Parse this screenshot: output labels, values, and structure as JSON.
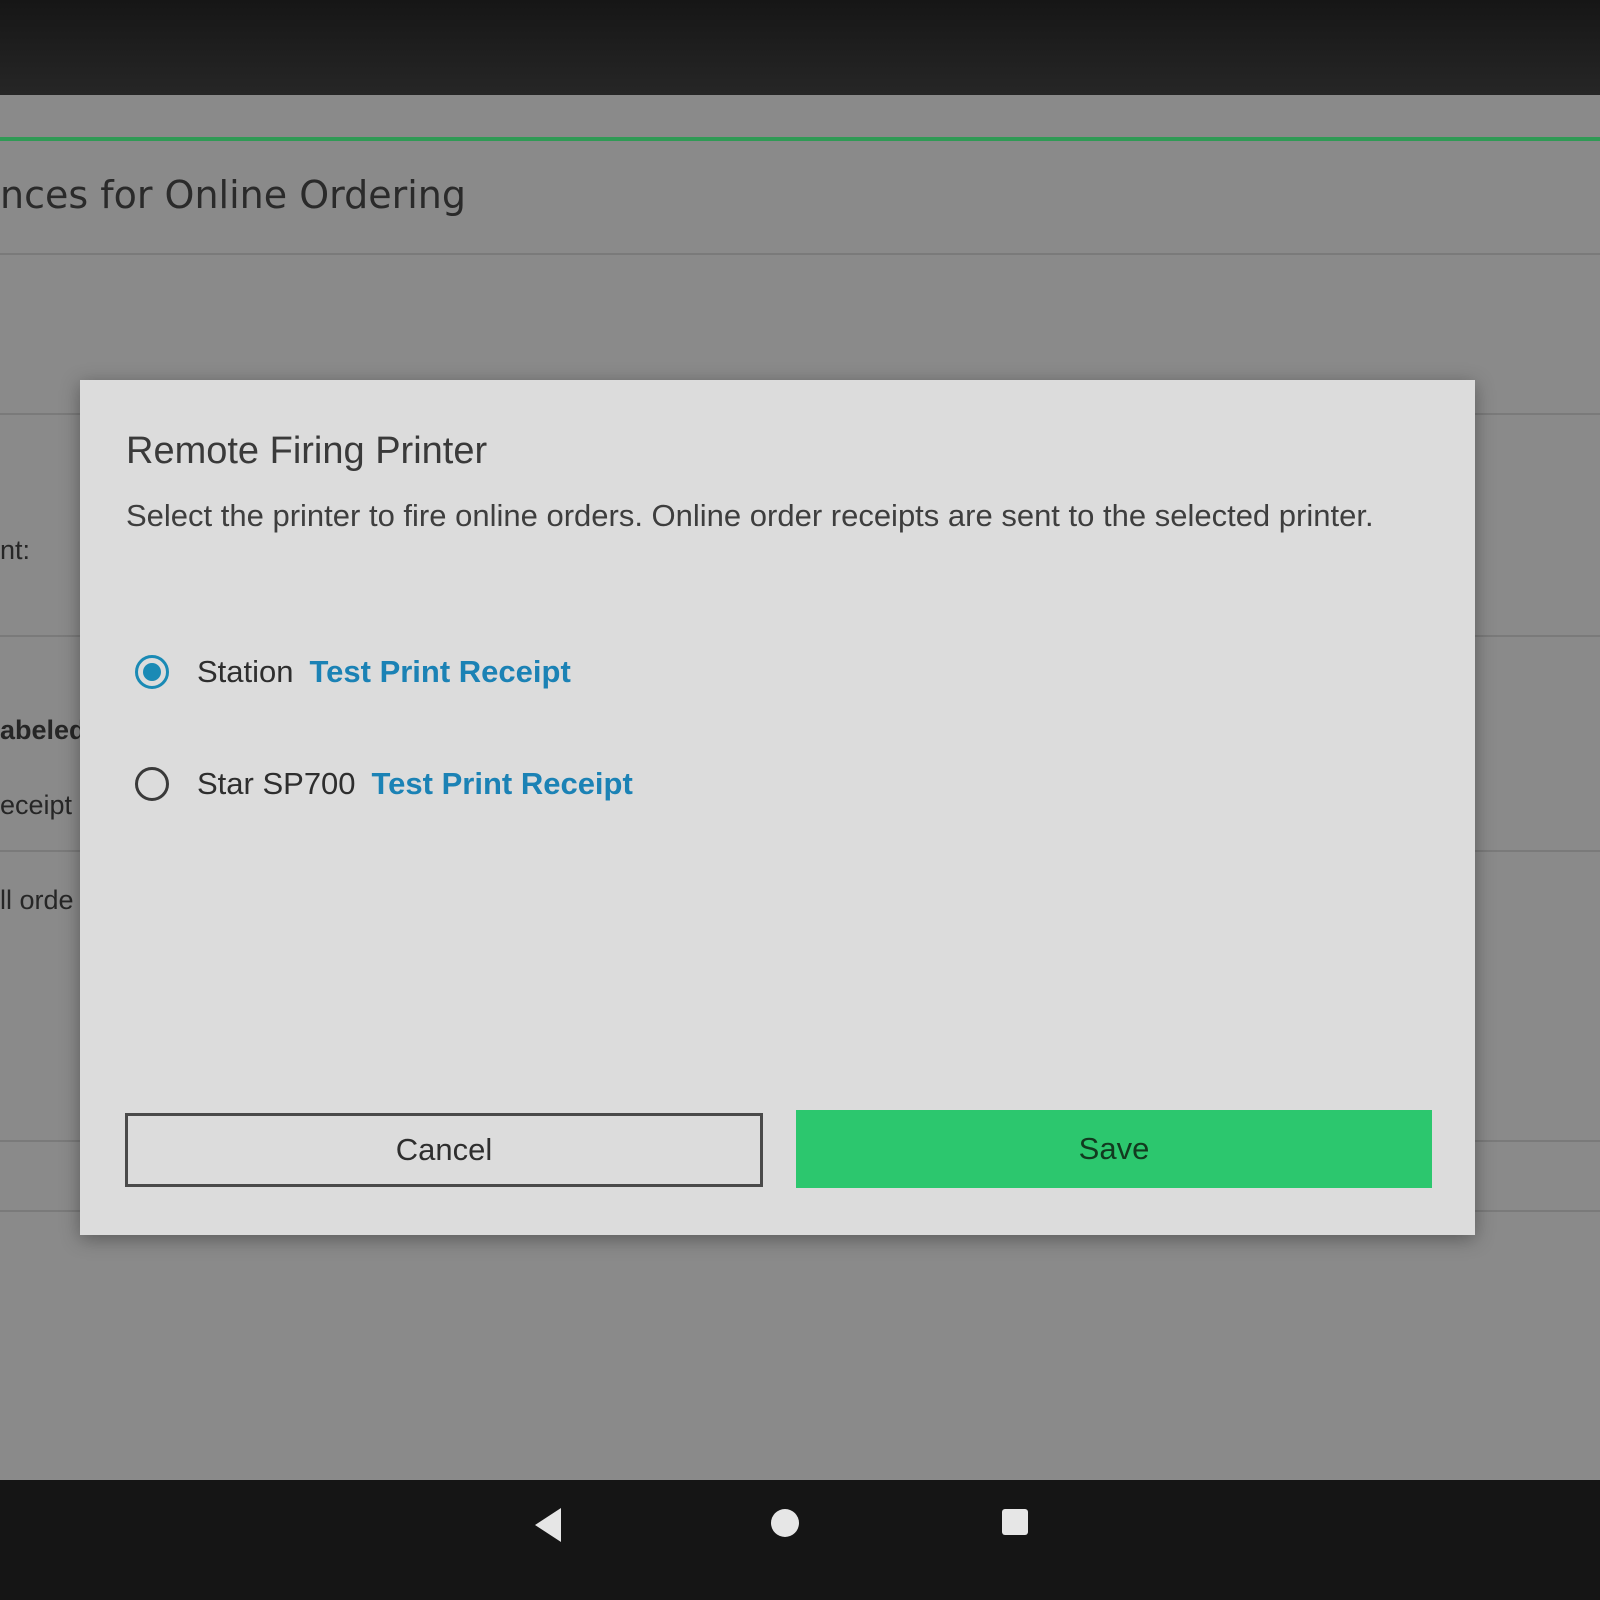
{
  "background": {
    "page_title_fragment": "nces for Online Ordering",
    "fragments": {
      "nt": "nt:",
      "abeled": "abeled",
      "eceipt": "eceipt",
      "ll_orde": "ll orde"
    }
  },
  "dialog": {
    "title": "Remote Firing Printer",
    "description": "Select the printer to fire online orders. Online order receipts are sent to the selected printer.",
    "printers": [
      {
        "name": "Station",
        "test_link": "Test Print Receipt",
        "selected": true
      },
      {
        "name": "Star SP700",
        "test_link": "Test Print Receipt",
        "selected": false
      }
    ],
    "cancel_label": "Cancel",
    "save_label": "Save"
  },
  "colors": {
    "accent_blue": "#1a8ab5",
    "save_green": "#2cc76e",
    "header_line_green": "#2f9a55"
  },
  "navbar": {
    "icons": [
      "back-icon",
      "home-icon",
      "recent-apps-icon"
    ]
  }
}
